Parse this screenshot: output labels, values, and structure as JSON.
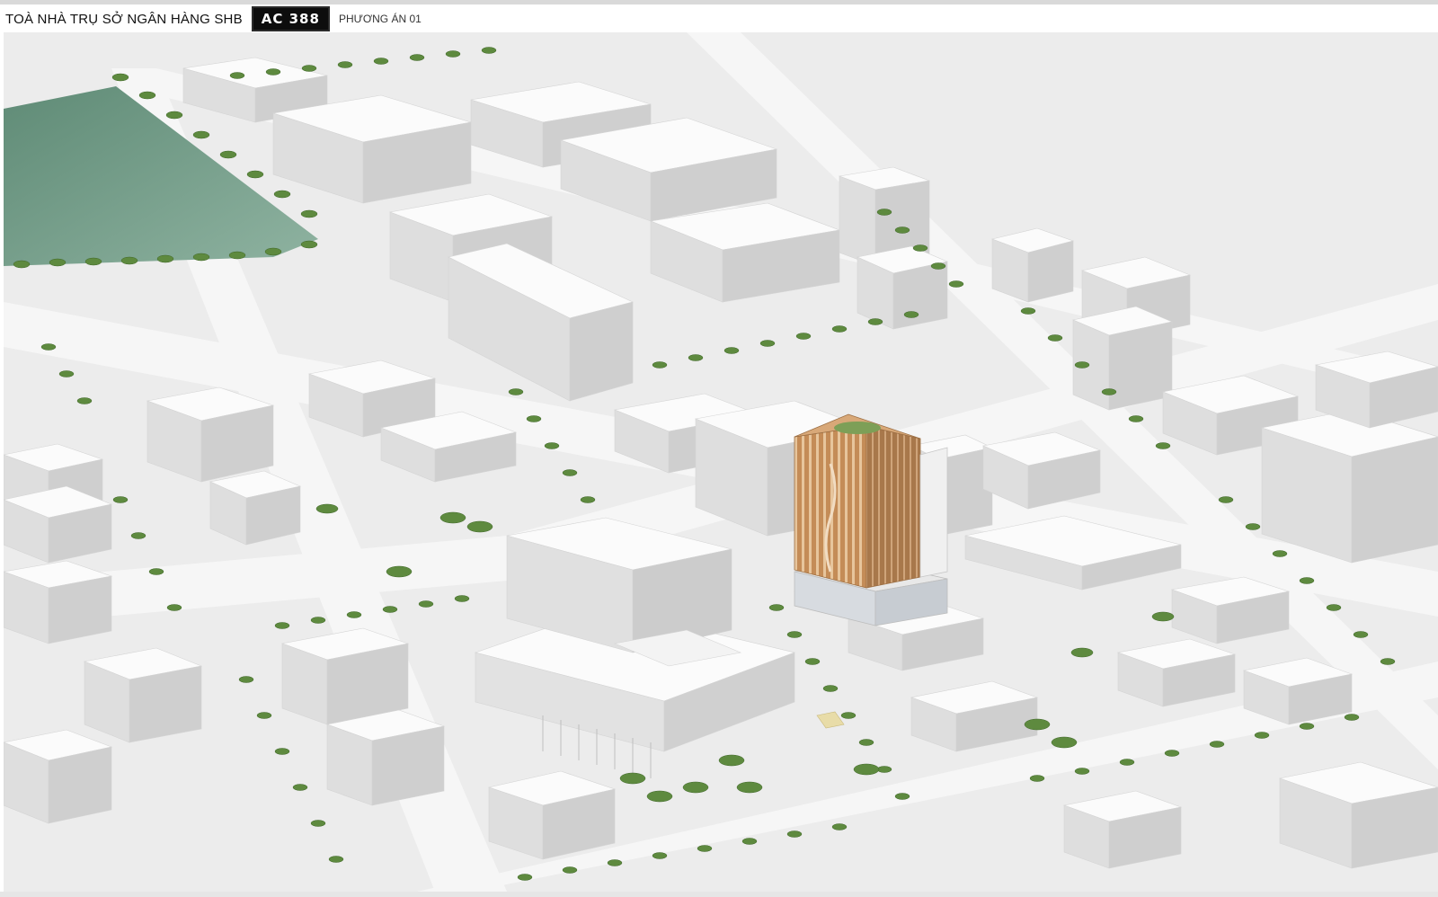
{
  "header": {
    "title": "TOÀ NHÀ TRỤ SỞ NGÂN HÀNG SHB",
    "badge": "AC 388",
    "subtitle": "PHƯƠNG ÁN 01"
  },
  "colors": {
    "ground": "#ececec",
    "street": "#f4f4f4",
    "building_top": "#fbfbfb",
    "building_left": "#dedede",
    "building_right": "#cfcfcf",
    "park": "#6f9a86",
    "tree": "#5e8a3f",
    "tower_facade": "#c8905a"
  }
}
